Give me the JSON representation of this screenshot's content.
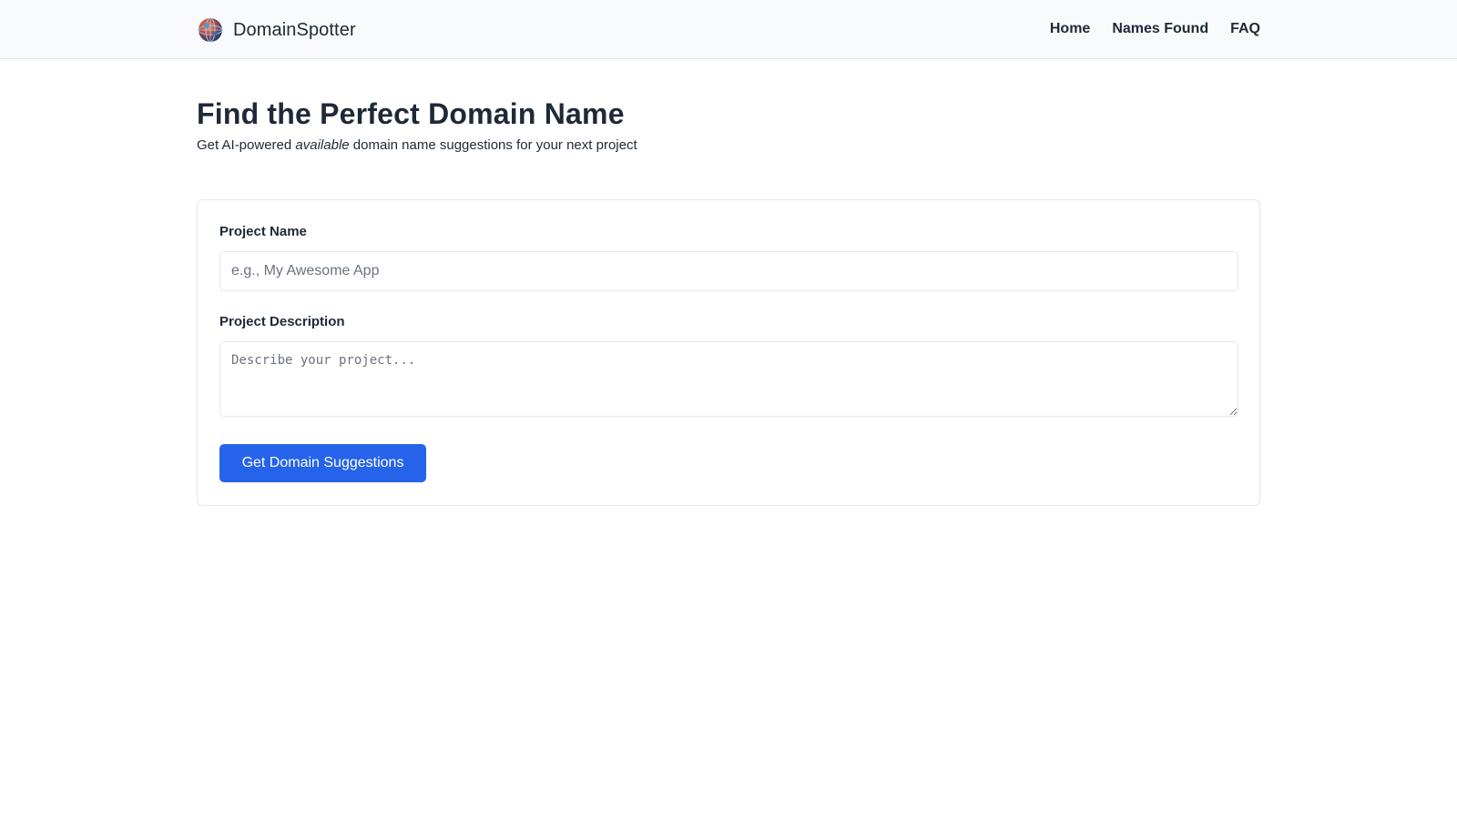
{
  "header": {
    "brand_name": "DomainSpotter",
    "logo_icon": "globe-icon",
    "nav": [
      {
        "label": "Home"
      },
      {
        "label": "Names Found"
      },
      {
        "label": "FAQ"
      }
    ]
  },
  "main": {
    "title": "Find the Perfect Domain Name",
    "subtitle_before": "Get AI-powered ",
    "subtitle_emphasis": "available",
    "subtitle_after": " domain name suggestions for your next project"
  },
  "form": {
    "project_name_label": "Project Name",
    "project_name_placeholder": "e.g., My Awesome App",
    "project_name_value": "",
    "project_description_label": "Project Description",
    "project_description_placeholder": "Describe your project...",
    "project_description_value": "",
    "submit_label": "Get Domain Suggestions"
  },
  "colors": {
    "primary": "#2563eb",
    "header_bg": "#f9fafb",
    "text": "#1f2937",
    "border": "#e5e7eb"
  }
}
